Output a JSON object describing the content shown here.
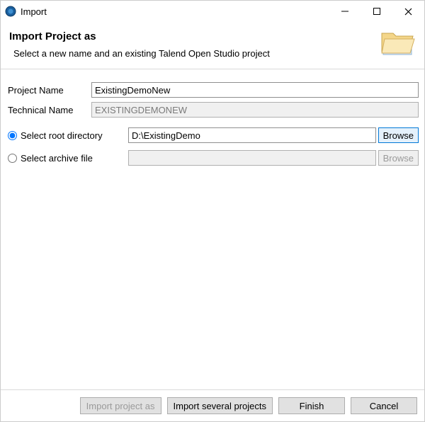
{
  "titlebar": {
    "title": "Import"
  },
  "header": {
    "title": "Import Project as",
    "description": "Select a new name and an existing Talend Open Studio project"
  },
  "fields": {
    "projectName": {
      "label": "Project Name",
      "value": "ExistingDemoNew"
    },
    "technicalName": {
      "label": "Technical Name",
      "value": "EXISTINGDEMONEW"
    }
  },
  "source": {
    "rootDir": {
      "label": "Select root directory",
      "value": "D:\\ExistingDemo",
      "browse": "Browse"
    },
    "archive": {
      "label": "Select archive file",
      "value": "",
      "browse": "Browse"
    }
  },
  "footer": {
    "importAs": "Import project as",
    "importSeveral": "Import several projects",
    "finish": "Finish",
    "cancel": "Cancel"
  }
}
